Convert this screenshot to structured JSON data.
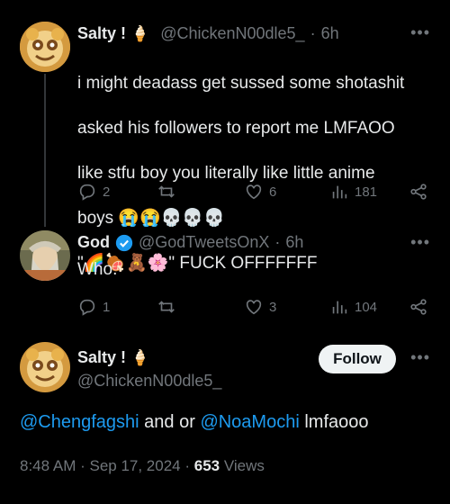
{
  "tweet1": {
    "name": "Salty !",
    "handle": "@ChickenN00dle5_",
    "dot": "·",
    "time": "6h",
    "line1": "i might deadass get sussed some shotashit",
    "line2": "asked his followers to report me LMFAOO",
    "line3": "like stfu boy you literally like little anime",
    "line4_text": "boys",
    "line4_emoji": "😭😭💀💀💀",
    "line5_open": "\"",
    "line5_emoji": "🌈🍖🧸🌸",
    "line5_text": "\" FUCK OFFFFFFF",
    "replies": "2",
    "retweets": "",
    "likes": "6",
    "views": "181"
  },
  "tweet2": {
    "name": "God",
    "handle": "@GodTweetsOnX",
    "dot": "·",
    "time": "6h",
    "text": "Who.",
    "replies": "1",
    "retweets": "",
    "likes": "3",
    "views": "104"
  },
  "main": {
    "name": "Salty !",
    "handle": "@ChickenN00dle5_",
    "follow_label": "Follow",
    "mention1": "@Chengfagshi",
    "middle_text": " and or ",
    "mention2": "@NoaMochi",
    "end_text": " lmfaooo",
    "time": "8:48 AM",
    "sep": " · ",
    "date": "Sep 17, 2024",
    "views_count": "653",
    "views_label": " Views"
  },
  "icons": {
    "name_badge": "ice-cream-icon",
    "verified": "verified-badge-icon"
  },
  "colors": {
    "background": "#000000",
    "text": "#e7e9ea",
    "muted": "#71767b",
    "link": "#1d9bf0"
  }
}
